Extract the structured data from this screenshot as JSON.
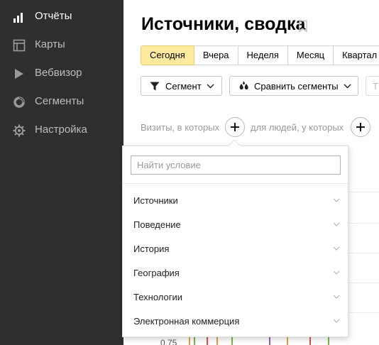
{
  "sidebar": {
    "items": [
      {
        "label": "Отчёты",
        "icon": "bar-chart-icon",
        "active": true
      },
      {
        "label": "Карты",
        "icon": "map-icon",
        "active": false
      },
      {
        "label": "Вебвизор",
        "icon": "play-icon",
        "active": false
      },
      {
        "label": "Сегменты",
        "icon": "segments-icon",
        "active": false
      },
      {
        "label": "Настройка",
        "icon": "gear-icon",
        "active": false
      }
    ]
  },
  "header": {
    "title": "Источники, сводка"
  },
  "periods": [
    {
      "label": "Сегодня",
      "selected": true
    },
    {
      "label": "Вчера",
      "selected": false
    },
    {
      "label": "Неделя",
      "selected": false
    },
    {
      "label": "Месяц",
      "selected": false
    },
    {
      "label": "Квартал",
      "selected": false
    }
  ],
  "toolbar": {
    "segment_label": "Сегмент",
    "compare_label": "Сравнить сегменты",
    "extra_label": "Т"
  },
  "conditions": {
    "visits_label": "Визиты, в которых",
    "people_label": "для людей, у которых"
  },
  "background": {
    "axis_value": "0.75"
  },
  "dropdown": {
    "search_placeholder": "Найти условие",
    "search_value": "",
    "items": [
      {
        "label": "Источники"
      },
      {
        "label": "Поведение"
      },
      {
        "label": "История"
      },
      {
        "label": "География"
      },
      {
        "label": "Технологии"
      },
      {
        "label": "Электронная коммерция"
      }
    ]
  },
  "colors": {
    "sidebar_bg": "#2f2f2f",
    "selected_period": "#ffeba0",
    "sidebar_active_text": "#ffffff",
    "sidebar_text": "#bdbdbd"
  }
}
